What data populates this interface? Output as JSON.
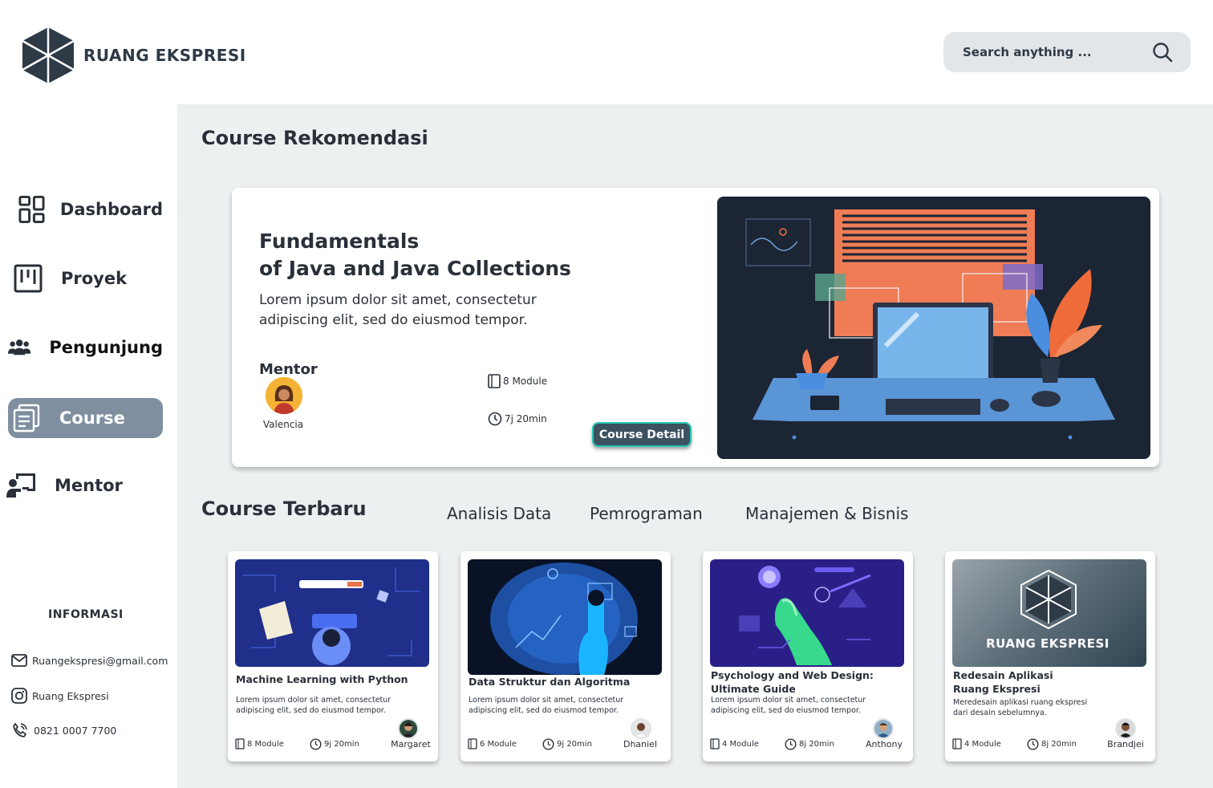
{
  "header": {
    "logo_text": "RUANG EKSPRESI",
    "search_placeholder": "Search anything ..."
  },
  "sidebar": {
    "items": [
      {
        "label": "Dashboard",
        "icon": "dashboard-icon",
        "active": false
      },
      {
        "label": "Proyek",
        "icon": "kanban-icon",
        "active": false
      },
      {
        "label": "Pengunjung",
        "icon": "people-icon",
        "active": false
      },
      {
        "label": "Course",
        "icon": "course-icon",
        "active": true
      },
      {
        "label": "Mentor",
        "icon": "mentor-icon",
        "active": false
      }
    ],
    "info": {
      "title": "INFORMASI",
      "email": "Ruangekspresi@gmail.com",
      "instagram": "Ruang Ekspresi",
      "phone": "0821 0007 7700"
    }
  },
  "main": {
    "recommendation_title": "Course Rekomendasi",
    "featured": {
      "title": "Fundamentals\nof Java and Java Collections",
      "description": "Lorem ipsum dolor sit amet, consectetur adipiscing elit, sed do eiusmod tempor.",
      "mentor_label": "Mentor",
      "mentor_name": "Valencia",
      "modules": "8 Module",
      "duration": "7j  20min",
      "button_label": "Course Detail"
    },
    "latest_title": "Course Terbaru",
    "tabs": [
      "Analisis Data",
      "Pemrograman",
      "Manajemen & Bisnis"
    ],
    "courses": [
      {
        "title": "Machine Learning with Python",
        "description": "Lorem ipsum dolor sit amet, consectetur\nadipiscing elit, sed do eiusmod tempor.",
        "modules": "8 Module",
        "duration": "9j 20min",
        "mentor": "Margaret"
      },
      {
        "title": "Data Struktur dan Algoritma",
        "description": "Lorem ipsum dolor sit amet, consectetur\nadipiscing elit, sed do eiusmod tempor.",
        "modules": "6 Module",
        "duration": "9j 20min",
        "mentor": "Dhaniel"
      },
      {
        "title": "Psychology and Web Design:\nUltimate Guide",
        "description": "Lorem ipsum dolor sit amet, consectetur\nadipiscing elit, sed do eiusmod tempor.",
        "modules": "4 Module",
        "duration": "8j 20min",
        "mentor": "Anthony"
      },
      {
        "title": "Redesain Aplikasi\nRuang Ekspresi",
        "description": "Meredesain aplikasi ruang ekspresi\ndari desain sebelumnya.",
        "modules": "4 Module",
        "duration": "8j 20min",
        "mentor": "Brandjei",
        "image_text": "RUANG EKSPRESI"
      }
    ]
  },
  "colors": {
    "active_nav": "#7f8fa0",
    "button": "#3c5260",
    "button_border": "#26c5b3",
    "main_bg": "#edf0f1"
  }
}
